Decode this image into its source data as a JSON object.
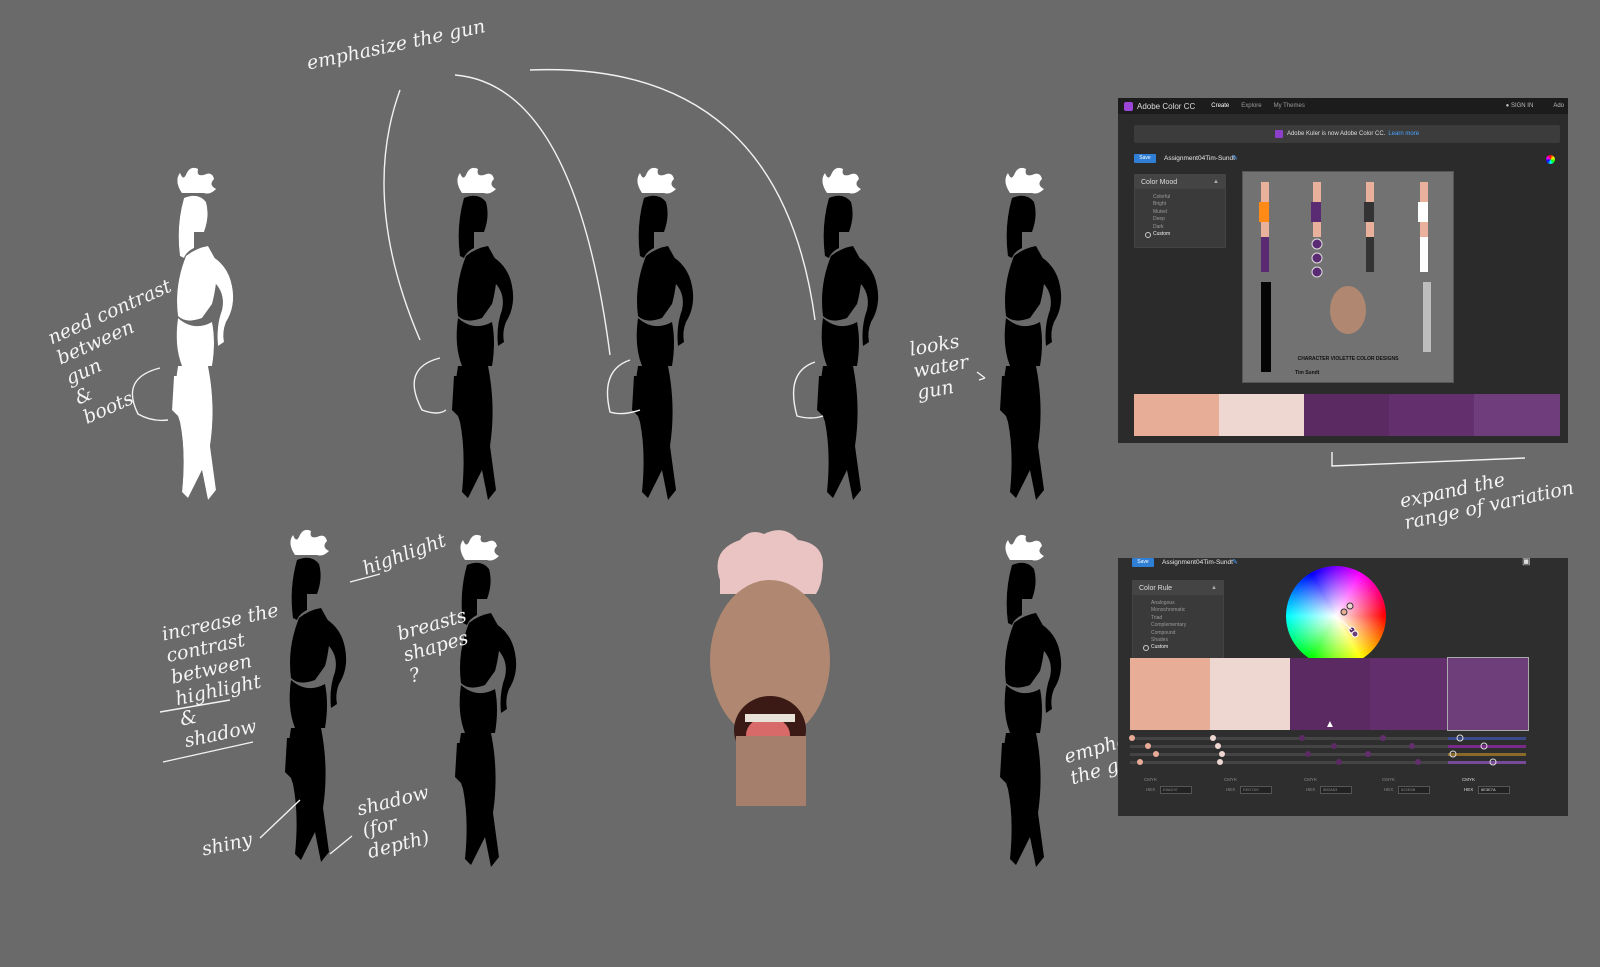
{
  "annotations": {
    "emphasize_gun": "emphasize the gun",
    "need_contrast": "need contrast\nbetween\ngun\n&\nboots",
    "looks_water_gun": "looks\nwater\ngun",
    "highlight": "highlight",
    "increase_contrast": "increase the\ncontrast\nbetween\nhighlight\n&\nshadow",
    "breasts_shapes": "breasts\nshapes\n?",
    "shiny": "shiny",
    "shadow_for_depth": "shadow\n(for\ndepth)",
    "expand_range": "expand the\nrange of variation",
    "emphasize_gun_2": "emphasize\nthe gun"
  },
  "panel_top": {
    "app_title": "Adobe Color CC",
    "nav": [
      "Create",
      "Explore",
      "My Themes"
    ],
    "sign_in": "SIGN IN",
    "adobe_short": "Ado",
    "banner_text": "Adobe Kuler is now Adobe Color CC.",
    "banner_link": "Learn more",
    "save_label": "Save",
    "theme_name": "Assignment04Tim-Sundt",
    "mood_title": "Color Mood",
    "mood_options": [
      "Colorful",
      "Bright",
      "Muted",
      "Deep",
      "Dark",
      "Custom"
    ],
    "image_caption": "CHARACTER VIOLETTE COLOR DESIGNS",
    "image_author": "Tim Sundt",
    "swatches": [
      "#e8ad97",
      "#eed7d0",
      "#5b2a63",
      "#632f6c",
      "#6f3d7b"
    ]
  },
  "panel_bottom": {
    "save_label": "Save",
    "theme_name": "Assignment04Tim-Sundt",
    "rule_title": "Color Rule",
    "rule_options": [
      "Analogous",
      "Monochromatic",
      "Triad",
      "Complementary",
      "Compound",
      "Shades",
      "Custom"
    ],
    "swatches": [
      "#e8ad97",
      "#eed7d0",
      "#5b2a63",
      "#622e6b",
      "#6e3e7a"
    ],
    "cmyk_label": "CMYK",
    "hex_label": "HEX",
    "hex_values": [
      "E8AD97",
      "EED7D0",
      "5B2A63",
      "622E6B",
      "6E3E7A"
    ]
  },
  "colors": {
    "orange": "#ff8a16",
    "purple": "#5a2a73",
    "red": "#c4161c",
    "yellow": "#f1b417",
    "skin": "#e9b19b"
  }
}
